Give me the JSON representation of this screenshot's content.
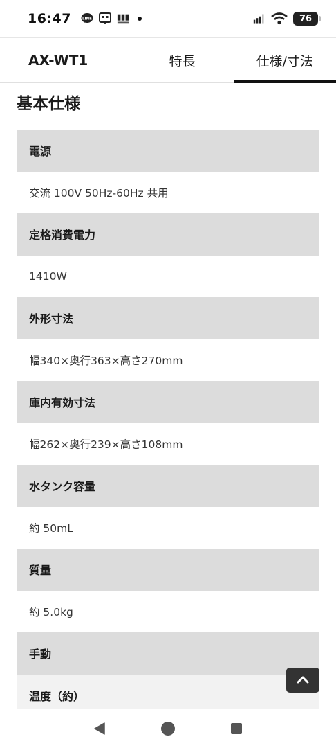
{
  "status_bar": {
    "time": "16:47",
    "battery": "76",
    "icons": [
      "line-app-icon",
      "message-icon",
      "news-app-icon",
      "notification-dot-icon",
      "signal-icon",
      "wifi-icon",
      "battery-icon"
    ]
  },
  "tabs": [
    {
      "label": "AX-WT1",
      "active": false
    },
    {
      "label": "特長",
      "active": false
    },
    {
      "label": "仕様/寸法",
      "active": true
    }
  ],
  "section_title": "基本仕様",
  "specs": [
    {
      "label": "電源",
      "value": "交流 100V 50Hz-60Hz 共用"
    },
    {
      "label": "定格消費電力",
      "value": "1410W"
    },
    {
      "label": "外形寸法",
      "value": "幅340×奥行363×高さ270mm"
    },
    {
      "label": "庫内有効寸法",
      "value": "幅262×奥行239×高さ108mm"
    },
    {
      "label": "水タンク容量",
      "value": "約 50mL"
    },
    {
      "label": "質量",
      "value": "約 5.0kg"
    }
  ],
  "partial_rows": {
    "manual": "手動",
    "temperature": "温度（約）"
  },
  "colors": {
    "header_row_bg": "#dcdcdc",
    "active_tab_indicator": "#111111",
    "to_top_button_bg": "#333333"
  },
  "nav": [
    "back-icon",
    "home-icon",
    "recents-icon"
  ]
}
